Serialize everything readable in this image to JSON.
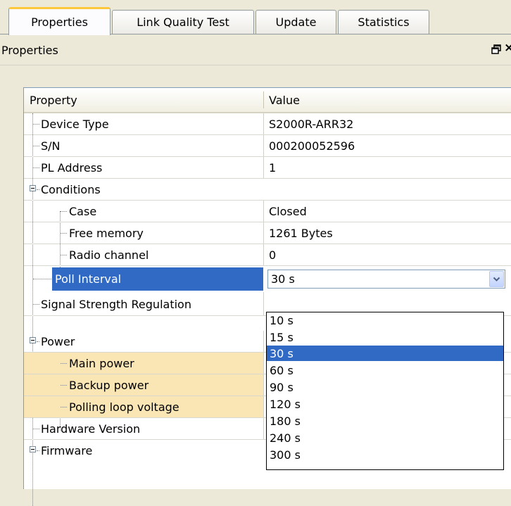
{
  "tabs": [
    {
      "label": "Properties",
      "active": true
    },
    {
      "label": "Link Quality Test",
      "active": false
    },
    {
      "label": "Update",
      "active": false
    },
    {
      "label": "Statistics",
      "active": false
    }
  ],
  "panel": {
    "title": "Properties",
    "restore_icon": "restore-window-icon",
    "close_glyph": "×"
  },
  "grid": {
    "col_property": "Property",
    "col_value": "Value",
    "rows": {
      "device_type": {
        "label": "Device Type",
        "value": "S2000R-ARR32"
      },
      "sn": {
        "label": "S/N",
        "value": "000200052596"
      },
      "pl_address": {
        "label": "PL Address",
        "value": "1"
      },
      "conditions": {
        "label": "Conditions"
      },
      "case": {
        "label": "Case",
        "value": "Closed"
      },
      "free_memory": {
        "label": "Free memory",
        "value": "1261 Bytes"
      },
      "radio_channel": {
        "label": "Radio channel",
        "value": "0"
      },
      "poll_interval": {
        "label": "Poll Interval",
        "value": "30 s"
      },
      "signal_strength": {
        "label": "Signal Strength Regulation"
      },
      "power": {
        "label": "Power"
      },
      "main_power": {
        "label": "Main power"
      },
      "backup_power": {
        "label": "Backup power"
      },
      "polling_loop_voltage": {
        "label": "Polling loop voltage"
      },
      "hardware_version": {
        "label": "Hardware Version"
      },
      "firmware": {
        "label": "Firmware"
      }
    }
  },
  "dropdown": {
    "options": [
      "10 s",
      "15 s",
      "30 s",
      "60 s",
      "90 s",
      "120 s",
      "180 s",
      "240 s",
      "300 s"
    ],
    "selected": "30 s"
  },
  "colors": {
    "selection": "#316ac5",
    "highlight_rows": "#fae5b4",
    "active_tab_accent": "#ffc83c"
  }
}
